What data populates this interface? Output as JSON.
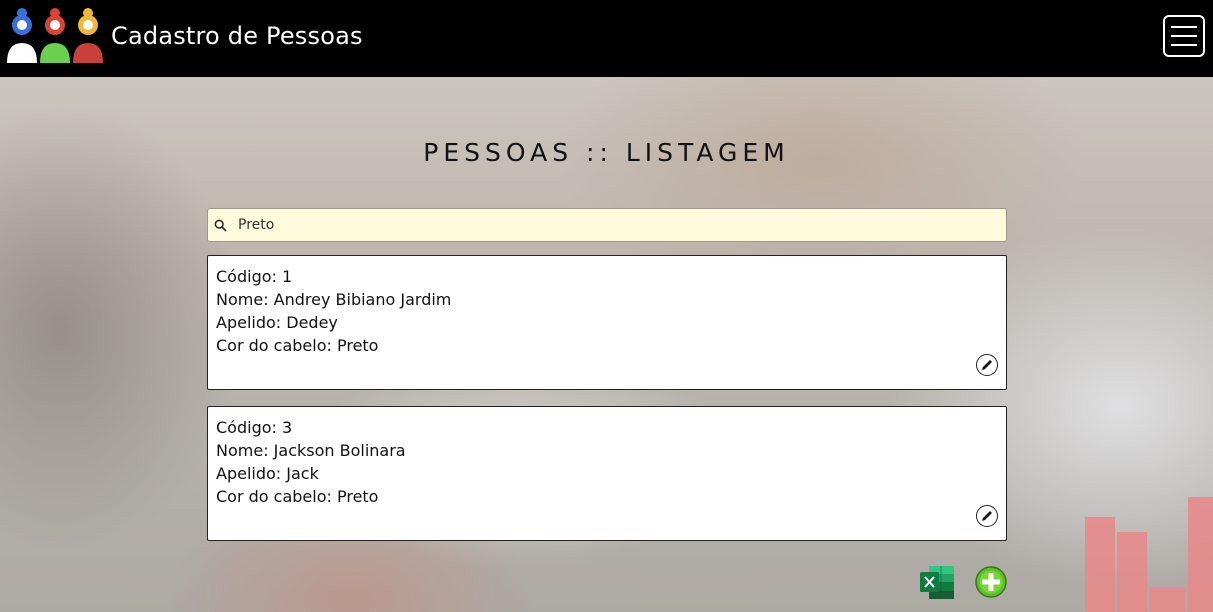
{
  "header": {
    "brand": "Cadastro de Pessoas",
    "logo_icon": "people-group-icon",
    "menu_icon": "hamburger-menu-icon"
  },
  "page": {
    "title": "PESSOAS :: LISTAGEM"
  },
  "search": {
    "icon": "search-icon",
    "value": "Preto"
  },
  "people": [
    {
      "codigo": "Código: 1",
      "nome": "Nome: Andrey Bibiano Jardim",
      "apelido": "Apelido: Dedey",
      "cabelo": "Cor do cabelo: Preto"
    },
    {
      "codigo": "Código: 3",
      "nome": "Nome: Jackson Bolinara",
      "apelido": "Apelido: Jack",
      "cabelo": "Cor do cabelo: Preto"
    }
  ],
  "actions": {
    "edit_icon": "pencil-icon",
    "export_icon": "excel-icon",
    "add_icon": "plus-circle-icon"
  },
  "colors": {
    "header_bg": "#000000",
    "search_bg": "#fdfbdc",
    "excel_green": "#1d7044",
    "add_green": "#4caf28"
  }
}
